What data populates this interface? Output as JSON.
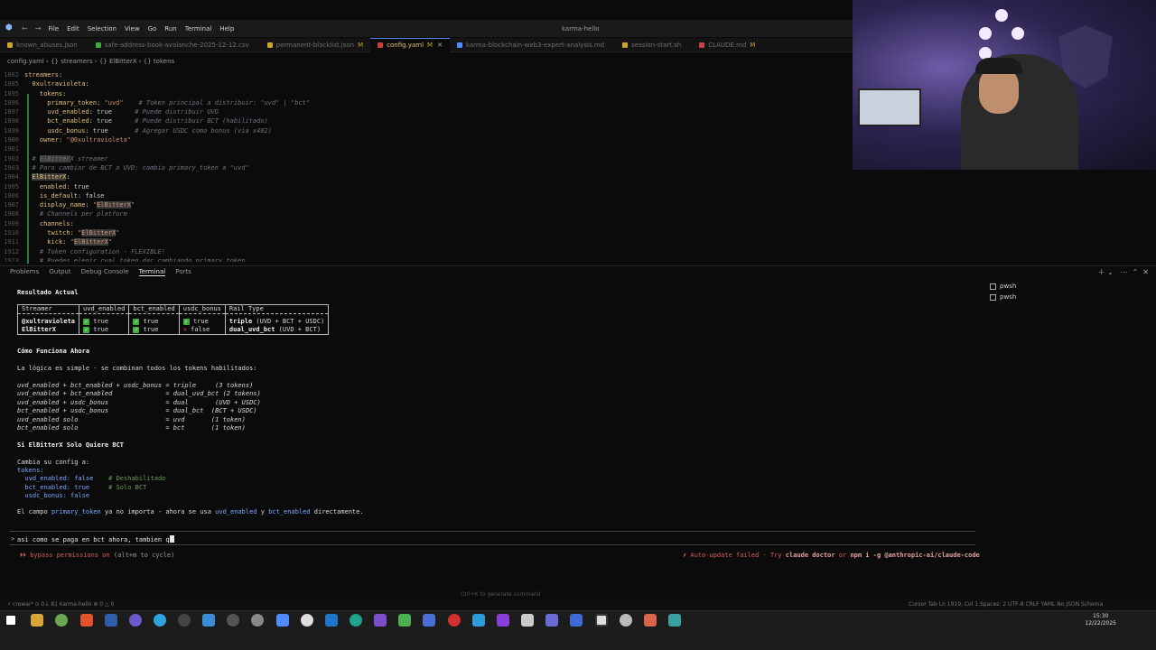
{
  "menu": [
    "File",
    "Edit",
    "Selection",
    "View",
    "Go",
    "Run",
    "Terminal",
    "Help"
  ],
  "window_title": "karma-hello",
  "tabs": [
    {
      "label": "known_abuses.json",
      "color": "#c9a227",
      "active": false,
      "modified": ""
    },
    {
      "label": "safe-address-book-avalanche-2025-12-12.csv",
      "color": "#3fae3f",
      "active": false,
      "modified": ""
    },
    {
      "label": "permanent-blacklist.json",
      "color": "#c9a227",
      "active": false,
      "modified": "M"
    },
    {
      "label": "config.yaml",
      "color": "#c9433f",
      "active": true,
      "modified": "M"
    },
    {
      "label": "karma-blockchain-web3-expert-analysis.md",
      "color": "#4f8cff",
      "active": false,
      "modified": ""
    },
    {
      "label": "session-start.sh",
      "color": "#c9a227",
      "active": false,
      "modified": ""
    },
    {
      "label": "CLAUDE.md",
      "color": "#c9433f",
      "active": false,
      "modified": "M"
    }
  ],
  "breadcrumb": "config.yaml  ›  {} streamers  ›  {} ElBitterX  ›  {} tokens",
  "code_lines": [
    {
      "n": "1882",
      "html": "<span class='k'>streamers</span>:"
    },
    {
      "n": "1885",
      "html": "  <span class='k'>0xultravioleta</span>:"
    },
    {
      "n": "1895",
      "html": "    <span class='k'>tokens</span>:"
    },
    {
      "n": "1896",
      "html": "      <span class='k'>primary_token</span>: <span class='s'>\"uvd\"</span>    <span class='c'># Token principal a distribuir: \"uvd\" | \"bct\"</span>"
    },
    {
      "n": "1897",
      "html": "      <span class='k'>uvd_enabled</span>: <span class='b'>true</span>      <span class='c'># Puede distribuir UVD</span>"
    },
    {
      "n": "1898",
      "html": "      <span class='k'>bct_enabled</span>: <span class='b'>true</span>      <span class='c'># Puede distribuir BCT (habilitado)</span>"
    },
    {
      "n": "1899",
      "html": "      <span class='k'>usdc_bonus</span>: <span class='b'>true</span>       <span class='c'># Agregar USDC como bonus (via x402)</span>"
    },
    {
      "n": "1900",
      "html": "    <span class='k'>owner</span>: <span class='s'>\"@0xultravioleta\"</span>"
    },
    {
      "n": "1901",
      "html": ""
    },
    {
      "n": "1902",
      "html": "  <span class='c'># <span class='hl'>ElBitter</span>X streamer</span>"
    },
    {
      "n": "1903",
      "html": "  <span class='c'># Para cambiar de BCT a UVD: cambia primary_token a \"uvd\"</span>"
    },
    {
      "n": "1904",
      "html": "  <span class='k hl'>ElBitterX</span>:"
    },
    {
      "n": "1905",
      "html": "    <span class='k'>enabled</span>: <span class='b'>true</span>"
    },
    {
      "n": "1906",
      "html": "    <span class='k'>is_default</span>: <span class='b'>false</span>"
    },
    {
      "n": "1907",
      "html": "    <span class='k'>display_name</span>: <span class='s'>\"<span class='hl'>ElBitterX</span>\"</span>"
    },
    {
      "n": "1908",
      "html": "    <span class='c'># Channels per platform</span>"
    },
    {
      "n": "1909",
      "html": "    <span class='k'>channels</span>:"
    },
    {
      "n": "1910",
      "html": "      <span class='k'>twitch</span>: <span class='s'>\"<span class='hl'>ElBitterX</span>\"</span>"
    },
    {
      "n": "1911",
      "html": "      <span class='k'>kick</span>: <span class='s'>\"<span class='hl'>ElBitterX</span>\"</span>"
    },
    {
      "n": "1912",
      "html": "    <span class='c'># Token configuration - FLEXIBLE!</span>"
    },
    {
      "n": "1913",
      "html": "    <span class='c'># Puedes elegir cual token dar cambiando primary_token</span>"
    }
  ],
  "panel_tabs": [
    "Problems",
    "Output",
    "Debug Console",
    "Terminal",
    "Ports"
  ],
  "terminal": {
    "heading1": "Resultado Actual",
    "table_headers": [
      "Streamer",
      "uvd_enabled",
      "bct_enabled",
      "usdc_bonus",
      "Rail Type"
    ],
    "rows": [
      {
        "streamer": "@xultravioleta",
        "uvd": "true",
        "bct": "true",
        "usdc": "true",
        "usdc_ok": true,
        "rail": "triple",
        "rail_detail": " (UVD + BCT + USDC)"
      },
      {
        "streamer": "ElBitterX",
        "uvd": "true",
        "bct": "true",
        "usdc": "false",
        "usdc_ok": false,
        "rail": "dual_uvd_bct",
        "rail_detail": " (UVD + BCT)"
      }
    ],
    "heading2": "Cómo Funciona Ahora",
    "logic_intro": "La lógica es simple - se combinan todos los tokens habilitados:",
    "logic_lines": [
      "uvd_enabled + bct_enabled + usdc_bonus = triple     (3 tokens)",
      "uvd_enabled + bct_enabled              = dual_uvd_bct (2 tokens)",
      "uvd_enabled + usdc_bonus               = dual       (UVD + USDC)",
      "bct_enabled + usdc_bonus               = dual_bct  (BCT + USDC)",
      "uvd_enabled solo                       = uvd       (1 token)",
      "bct_enabled solo                       = bct       (1 token)"
    ],
    "heading3": "Si ElBitterX Solo Quiere BCT",
    "config_intro": "Cambia su config a:",
    "config_lines": [
      {
        "text": "tokens:",
        "comment": ""
      },
      {
        "text": "  uvd_enabled: false    ",
        "comment": "# Deshabilitado"
      },
      {
        "text": "  bct_enabled: true     ",
        "comment": "# Solo BCT"
      },
      {
        "text": "  usdc_bonus: false",
        "comment": ""
      }
    ],
    "closing_pre": "El campo ",
    "closing_code1": "primary_token",
    "closing_mid": " ya no importa - ahora se usa ",
    "closing_code2": "uvd_enabled",
    "closing_and": " y ",
    "closing_code3": "bct_enabled",
    "closing_post": " directamente."
  },
  "input": {
    "prompt": ">",
    "text": "asi como se paga en bct ahora, tambien q"
  },
  "bypass": {
    "label": "⏵⏵ bypass permissions on",
    "hint": " (alt+m to cycle)"
  },
  "update": {
    "pre": "✗ Auto-update failed · Try ",
    "cmd1": "claude doctor",
    "mid": " or ",
    "cmd2": "npm i -g @anthropic-ai/claude-code"
  },
  "terminals": [
    "pwsh",
    "pwsh"
  ],
  "hint": "Ctrl+K to generate command",
  "status": {
    "left": "⚡ crewai*  ⊙ 0↓ 81  karma-hello  ⊗ 0 △ 0",
    "right": "Cursor Tab   Ln 1919, Col 1   Spaces: 2   UTF-8   CRLF   YAML   No JSON Schema"
  },
  "clock": {
    "time": "15:30",
    "date": "12/22/2025"
  }
}
